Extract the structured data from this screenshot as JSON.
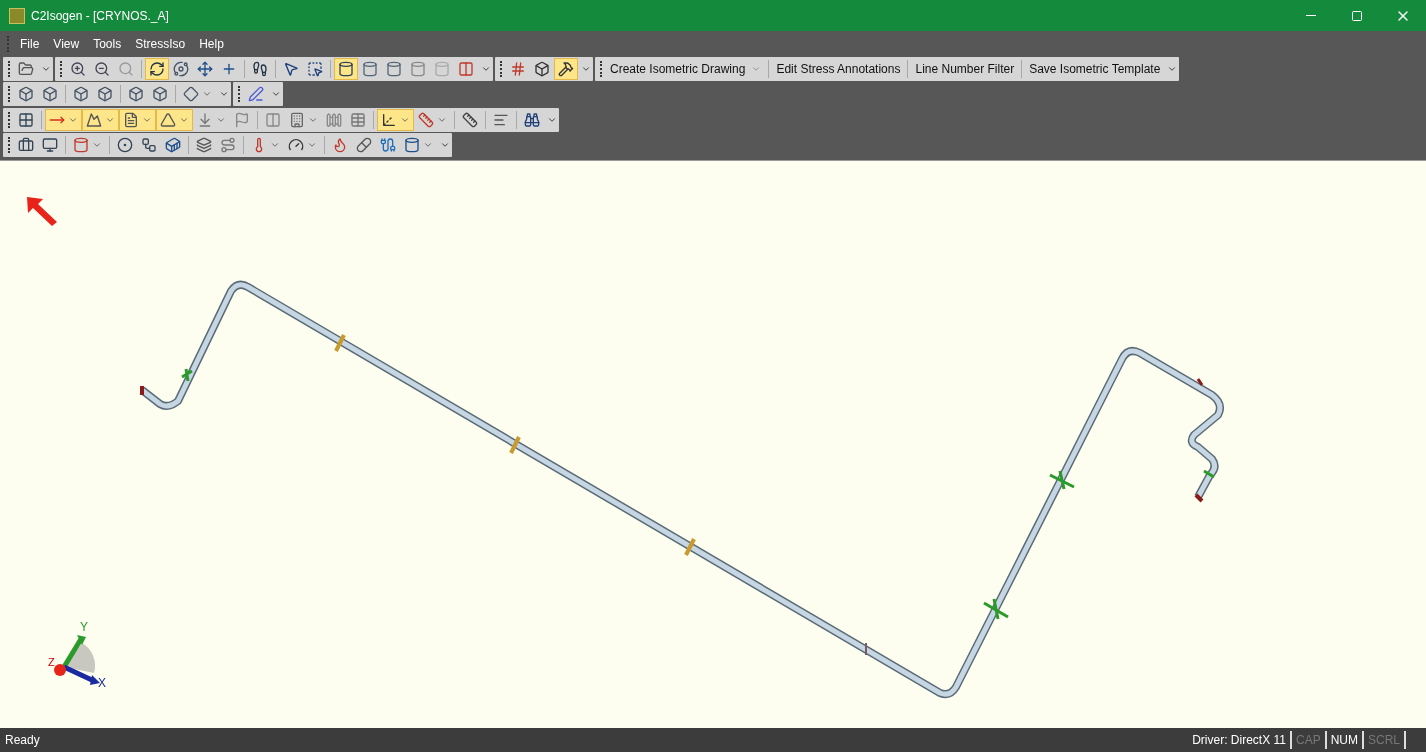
{
  "window": {
    "title": "C2Isogen - [CRYNOS._A]"
  },
  "menu": [
    {
      "label": "File"
    },
    {
      "label": "View"
    },
    {
      "label": "Tools"
    },
    {
      "label": "StressIso"
    },
    {
      "label": "Help"
    }
  ],
  "toolbar_rows": [
    [
      {
        "buttons": [
          {
            "kind": "icon",
            "active": false
          }
        ]
      },
      {
        "buttons": [
          {
            "kind": "icon",
            "active": false
          },
          {
            "kind": "icon",
            "active": false
          },
          {
            "kind": "icon",
            "active": false
          },
          {
            "kind": "separator"
          },
          {
            "kind": "icon",
            "active": true
          },
          {
            "kind": "icon",
            "active": false
          },
          {
            "kind": "icon",
            "active": false
          },
          {
            "kind": "icon",
            "active": false
          },
          {
            "kind": "separator"
          },
          {
            "kind": "icon",
            "active": false
          },
          {
            "kind": "separator"
          },
          {
            "kind": "icon",
            "active": false
          },
          {
            "kind": "icon",
            "active": false
          },
          {
            "kind": "separator"
          },
          {
            "kind": "icon",
            "active": true
          },
          {
            "kind": "icon",
            "active": false
          },
          {
            "kind": "icon",
            "active": false
          },
          {
            "kind": "icon",
            "active": false
          },
          {
            "kind": "icon",
            "active": false
          },
          {
            "kind": "icon",
            "active": false
          }
        ]
      },
      {
        "buttons": [
          {
            "kind": "icon",
            "active": false
          },
          {
            "kind": "icon",
            "active": false
          },
          {
            "kind": "icon",
            "active": true
          }
        ]
      },
      {
        "buttons": [
          {
            "kind": "menu",
            "label": "Create Isometric Drawing"
          },
          {
            "kind": "separator"
          },
          {
            "kind": "text",
            "label": "Edit Stress Annotations"
          },
          {
            "kind": "separator"
          },
          {
            "kind": "text",
            "label": "Line Number Filter"
          },
          {
            "kind": "separator"
          },
          {
            "kind": "text",
            "label": "Save Isometric Template"
          }
        ]
      }
    ],
    [
      {
        "buttons": [
          {
            "kind": "icon",
            "active": false
          },
          {
            "kind": "icon",
            "active": false
          },
          {
            "kind": "separator"
          },
          {
            "kind": "icon",
            "active": false
          },
          {
            "kind": "icon",
            "active": false
          },
          {
            "kind": "separator"
          },
          {
            "kind": "icon",
            "active": false
          },
          {
            "kind": "icon",
            "active": false
          },
          {
            "kind": "separator"
          },
          {
            "kind": "split",
            "active": false
          }
        ]
      },
      {
        "buttons": [
          {
            "kind": "icon",
            "active": false
          }
        ]
      }
    ],
    [
      {
        "buttons": [
          {
            "kind": "icon",
            "active": false
          },
          {
            "kind": "separator"
          },
          {
            "kind": "split",
            "active": true
          },
          {
            "kind": "split",
            "active": true
          },
          {
            "kind": "split",
            "active": true
          },
          {
            "kind": "split",
            "active": true
          },
          {
            "kind": "split",
            "active": false
          },
          {
            "kind": "icon",
            "active": false
          },
          {
            "kind": "separator"
          },
          {
            "kind": "icon",
            "active": false
          },
          {
            "kind": "split",
            "active": false
          },
          {
            "kind": "icon",
            "active": false
          },
          {
            "kind": "icon",
            "active": false
          },
          {
            "kind": "separator"
          },
          {
            "kind": "split",
            "active": true
          },
          {
            "kind": "split",
            "active": false
          },
          {
            "kind": "separator"
          },
          {
            "kind": "icon",
            "active": false
          },
          {
            "kind": "separator"
          },
          {
            "kind": "icon",
            "active": false
          },
          {
            "kind": "separator"
          },
          {
            "kind": "icon",
            "active": false
          }
        ]
      }
    ],
    [
      {
        "buttons": [
          {
            "kind": "icon",
            "active": false
          },
          {
            "kind": "icon",
            "active": false
          },
          {
            "kind": "separator"
          },
          {
            "kind": "split",
            "active": false
          },
          {
            "kind": "separator"
          },
          {
            "kind": "icon",
            "active": false
          },
          {
            "kind": "icon",
            "active": false
          },
          {
            "kind": "icon",
            "active": false
          },
          {
            "kind": "separator"
          },
          {
            "kind": "icon",
            "active": false
          },
          {
            "kind": "icon",
            "active": false
          },
          {
            "kind": "separator"
          },
          {
            "kind": "split",
            "active": false
          },
          {
            "kind": "split",
            "active": false
          },
          {
            "kind": "separator"
          },
          {
            "kind": "icon",
            "active": false
          },
          {
            "kind": "icon",
            "active": false
          },
          {
            "kind": "icon",
            "active": false
          },
          {
            "kind": "split",
            "active": false
          }
        ]
      }
    ]
  ],
  "axis_labels": [
    "X",
    "Y",
    "Z"
  ],
  "status": {
    "message": "Ready",
    "driver": "Driver: DirectX 11",
    "indicators": [
      {
        "label": "CAP",
        "on": false
      },
      {
        "label": "NUM",
        "on": true
      },
      {
        "label": "SCRL",
        "on": false
      }
    ]
  }
}
